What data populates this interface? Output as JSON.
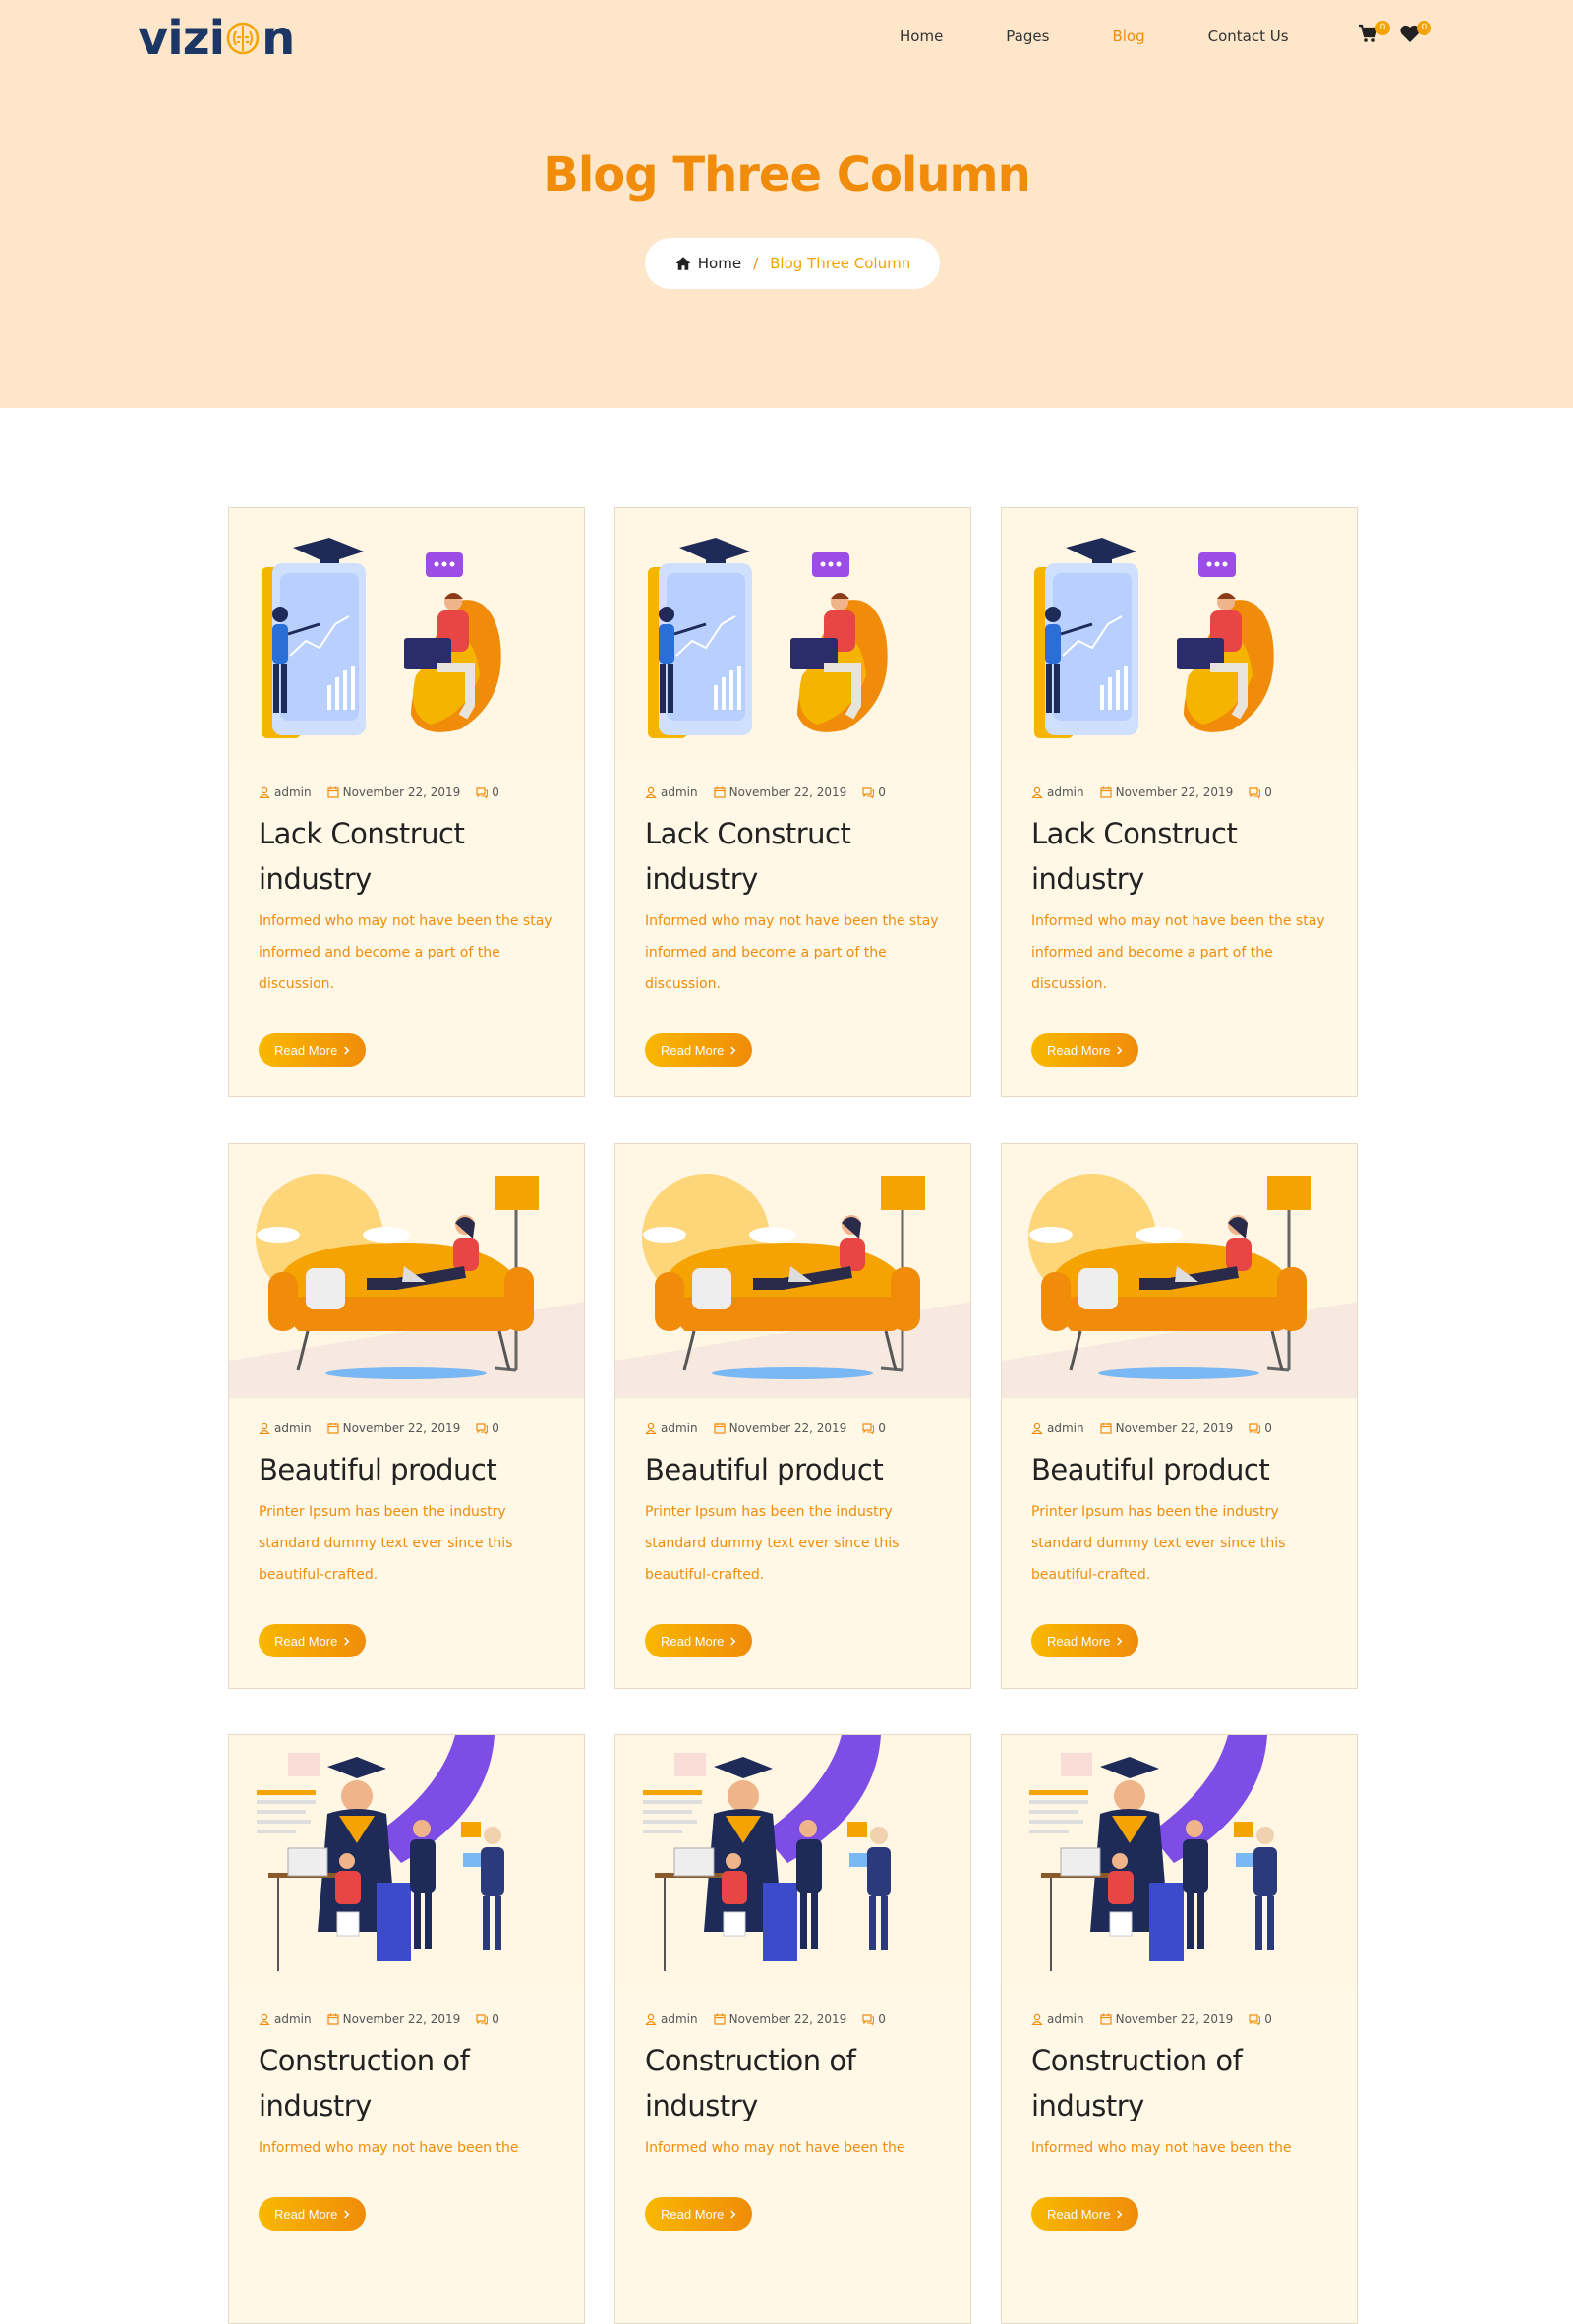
{
  "brand": {
    "logo_text_left": "vizi",
    "logo_text_right": "n"
  },
  "nav": {
    "items": [
      {
        "label": "Home",
        "active": false
      },
      {
        "label": "Pages",
        "active": false
      },
      {
        "label": "Blog",
        "active": true
      },
      {
        "label": "Contact Us",
        "active": false
      }
    ],
    "cart_count": "0",
    "wishlist_count": "0"
  },
  "hero": {
    "title": "Blog Three Column",
    "breadcrumb_home": "Home",
    "breadcrumb_sep": "/",
    "breadcrumb_current": "Blog Three Column"
  },
  "posts": [
    {
      "author": "admin",
      "date": "November 22, 2019",
      "comments": "0",
      "title": "Lack Construct industry",
      "excerpt": "Informed who may not have been the stay informed and become a part of the discussion.",
      "button": "Read More",
      "image": "learning-illustration"
    },
    {
      "author": "admin",
      "date": "November 22, 2019",
      "comments": "0",
      "title": "Lack Construct industry",
      "excerpt": "Informed who may not have been the stay informed and become a part of the discussion.",
      "button": "Read More",
      "image": "learning-illustration"
    },
    {
      "author": "admin",
      "date": "November 22, 2019",
      "comments": "0",
      "title": "Lack Construct industry",
      "excerpt": "Informed who may not have been the stay informed and become a part of the discussion.",
      "button": "Read More",
      "image": "learning-illustration"
    },
    {
      "author": "admin",
      "date": "November 22, 2019",
      "comments": "0",
      "title": "Beautiful product",
      "excerpt": "Printer Ipsum has been the industry standard dummy text ever since this beautiful-crafted.",
      "button": "Read More",
      "image": "sofa-illustration"
    },
    {
      "author": "admin",
      "date": "November 22, 2019",
      "comments": "0",
      "title": "Beautiful product",
      "excerpt": "Printer Ipsum has been the industry standard dummy text ever since this beautiful-crafted.",
      "button": "Read More",
      "image": "sofa-illustration"
    },
    {
      "author": "admin",
      "date": "November 22, 2019",
      "comments": "0",
      "title": "Beautiful product",
      "excerpt": "Printer Ipsum has been the industry standard dummy text ever since this beautiful-crafted.",
      "button": "Read More",
      "image": "sofa-illustration"
    },
    {
      "author": "admin",
      "date": "November 22, 2019",
      "comments": "0",
      "title": "Construction of industry",
      "excerpt": "Informed who may not have been the",
      "button": "Read More",
      "image": "graduation-illustration"
    },
    {
      "author": "admin",
      "date": "November 22, 2019",
      "comments": "0",
      "title": "Construction of industry",
      "excerpt": "Informed who may not have been the",
      "button": "Read More",
      "image": "graduation-illustration"
    },
    {
      "author": "admin",
      "date": "November 22, 2019",
      "comments": "0",
      "title": "Construction of industry",
      "excerpt": "Informed who may not have been the",
      "button": "Read More",
      "image": "graduation-illustration"
    }
  ],
  "colors": {
    "accent": "#f08c0a",
    "accent_light": "#f8b800",
    "hero_bg": "#fde6c9",
    "card_bg": "#fff8e6",
    "logo": "#1c3766"
  }
}
